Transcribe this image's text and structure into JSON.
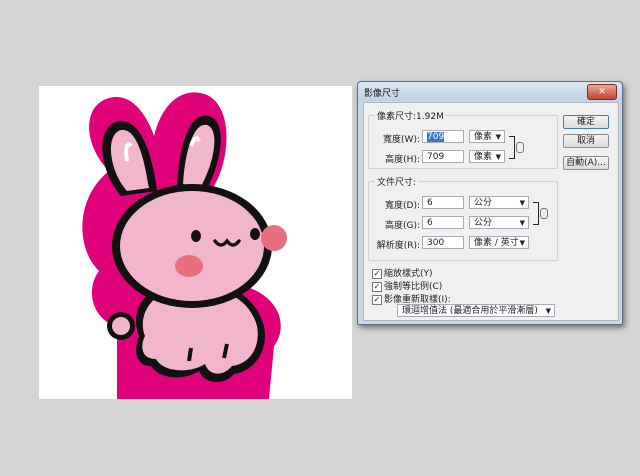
{
  "dialog": {
    "title": "影像尺寸",
    "close_label": "✕",
    "pixel_group": {
      "legend": "像素尺寸:1.92M",
      "width_label": "寬度(W):",
      "width_value": "709",
      "width_unit": "像素",
      "height_label": "高度(H):",
      "height_value": "709",
      "height_unit": "像素"
    },
    "doc_group": {
      "legend": "文件尺寸:",
      "width_label": "寬度(D):",
      "width_value": "6",
      "width_unit": "公分",
      "height_label": "高度(G):",
      "height_value": "6",
      "height_unit": "公分",
      "res_label": "解析度(R):",
      "res_value": "300",
      "res_unit": "像素 / 英寸"
    },
    "buttons": {
      "ok": "確定",
      "cancel": "取消",
      "auto": "自動(A)..."
    },
    "options": {
      "scale_styles": "縮放樣式(Y)",
      "constrain": "強制等比例(C)",
      "resample": "影像重新取樣(I):",
      "check_mark": "✓",
      "resample_method": "環迴增值法 (最適合用於平滑漸層)"
    }
  },
  "icons": {
    "combo_arrow": "▼"
  }
}
